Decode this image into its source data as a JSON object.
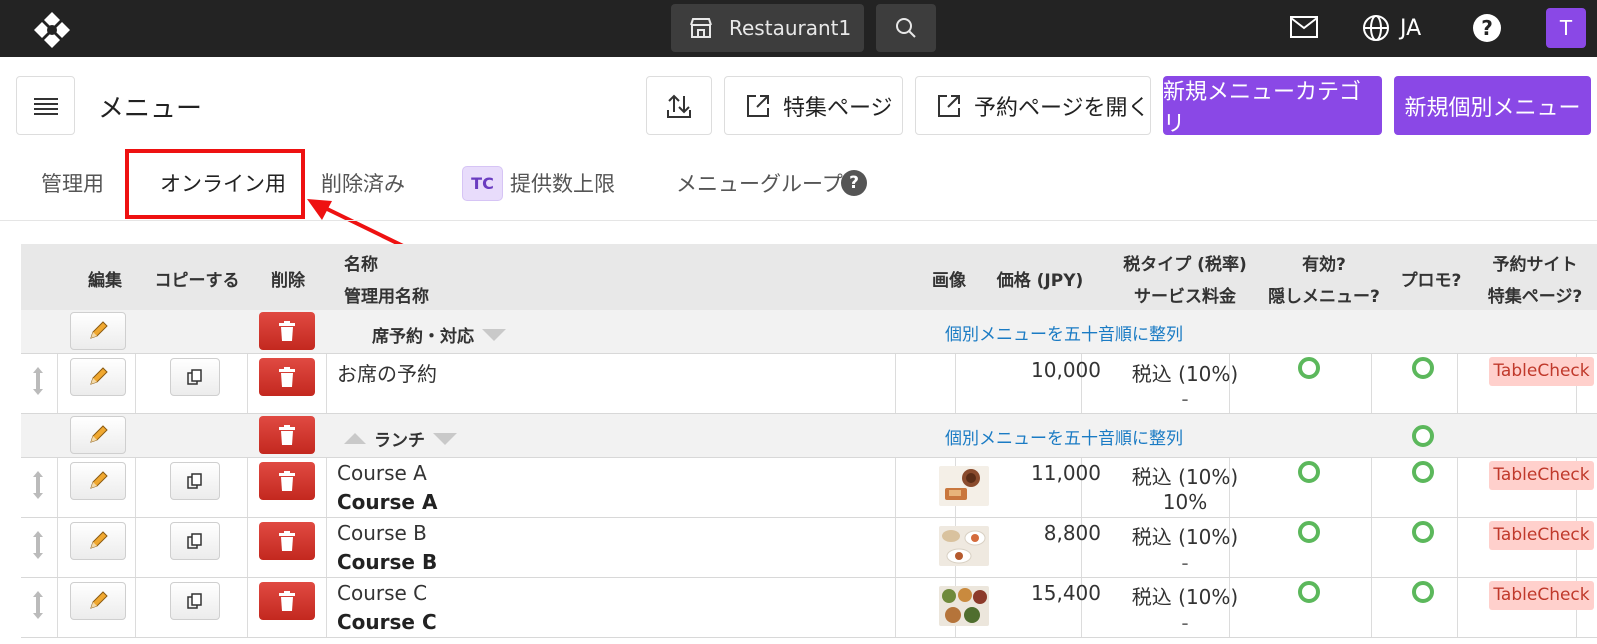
{
  "topbar": {
    "restaurant": "Restaurant1",
    "language": "JA",
    "help": "?",
    "avatar": "T"
  },
  "header": {
    "title": "メニュー",
    "feature_page": "特集ページ",
    "open_booking": "予約ページを開く",
    "new_category": "新規メニューカテゴリ",
    "new_item": "新規個別メニュー"
  },
  "tabs": {
    "admin": "管理用",
    "online": "オンライン用",
    "deleted": "削除済み",
    "tc": "TC",
    "limit": "提供数上限",
    "group": "メニューグループ",
    "help": "?"
  },
  "table": {
    "headers": {
      "edit": "編集",
      "copy": "コピーする",
      "delete": "削除",
      "name": "名称",
      "admin_name": "管理用名称",
      "image": "画像",
      "price": "価格 (JPY)",
      "tax_type": "税タイプ (税率)",
      "service": "サービス料金",
      "valid": "有効?",
      "hidden": "隠しメニュー?",
      "promo": "プロモ?",
      "site": "予約サイト",
      "feature": "特集ページ?"
    },
    "sort_link": "個別メニューを五十音順に整列",
    "categories": [
      {
        "name": "席予約・対応"
      },
      {
        "name": "ランチ"
      }
    ],
    "items": [
      {
        "name": "お席の予約",
        "admin_name": "",
        "price": "10,000",
        "tax": "税込 (10%)",
        "service": "-",
        "site": "TableCheck"
      },
      {
        "name": "Course A",
        "admin_name": "Course A",
        "price": "11,000",
        "tax": "税込 (10%)",
        "service": "10%",
        "site": "TableCheck"
      },
      {
        "name": "Course B",
        "admin_name": "Course B",
        "price": "8,800",
        "tax": "税込 (10%)",
        "service": "-",
        "site": "TableCheck"
      },
      {
        "name": "Course C",
        "admin_name": "Course C",
        "price": "15,400",
        "tax": "税込 (10%)",
        "service": "-",
        "site": "TableCheck"
      }
    ]
  },
  "colors": {
    "accent": "#8a48e6",
    "danger": "#d0342c",
    "valid": "#5cb85c",
    "highlight": "#ee1111"
  }
}
